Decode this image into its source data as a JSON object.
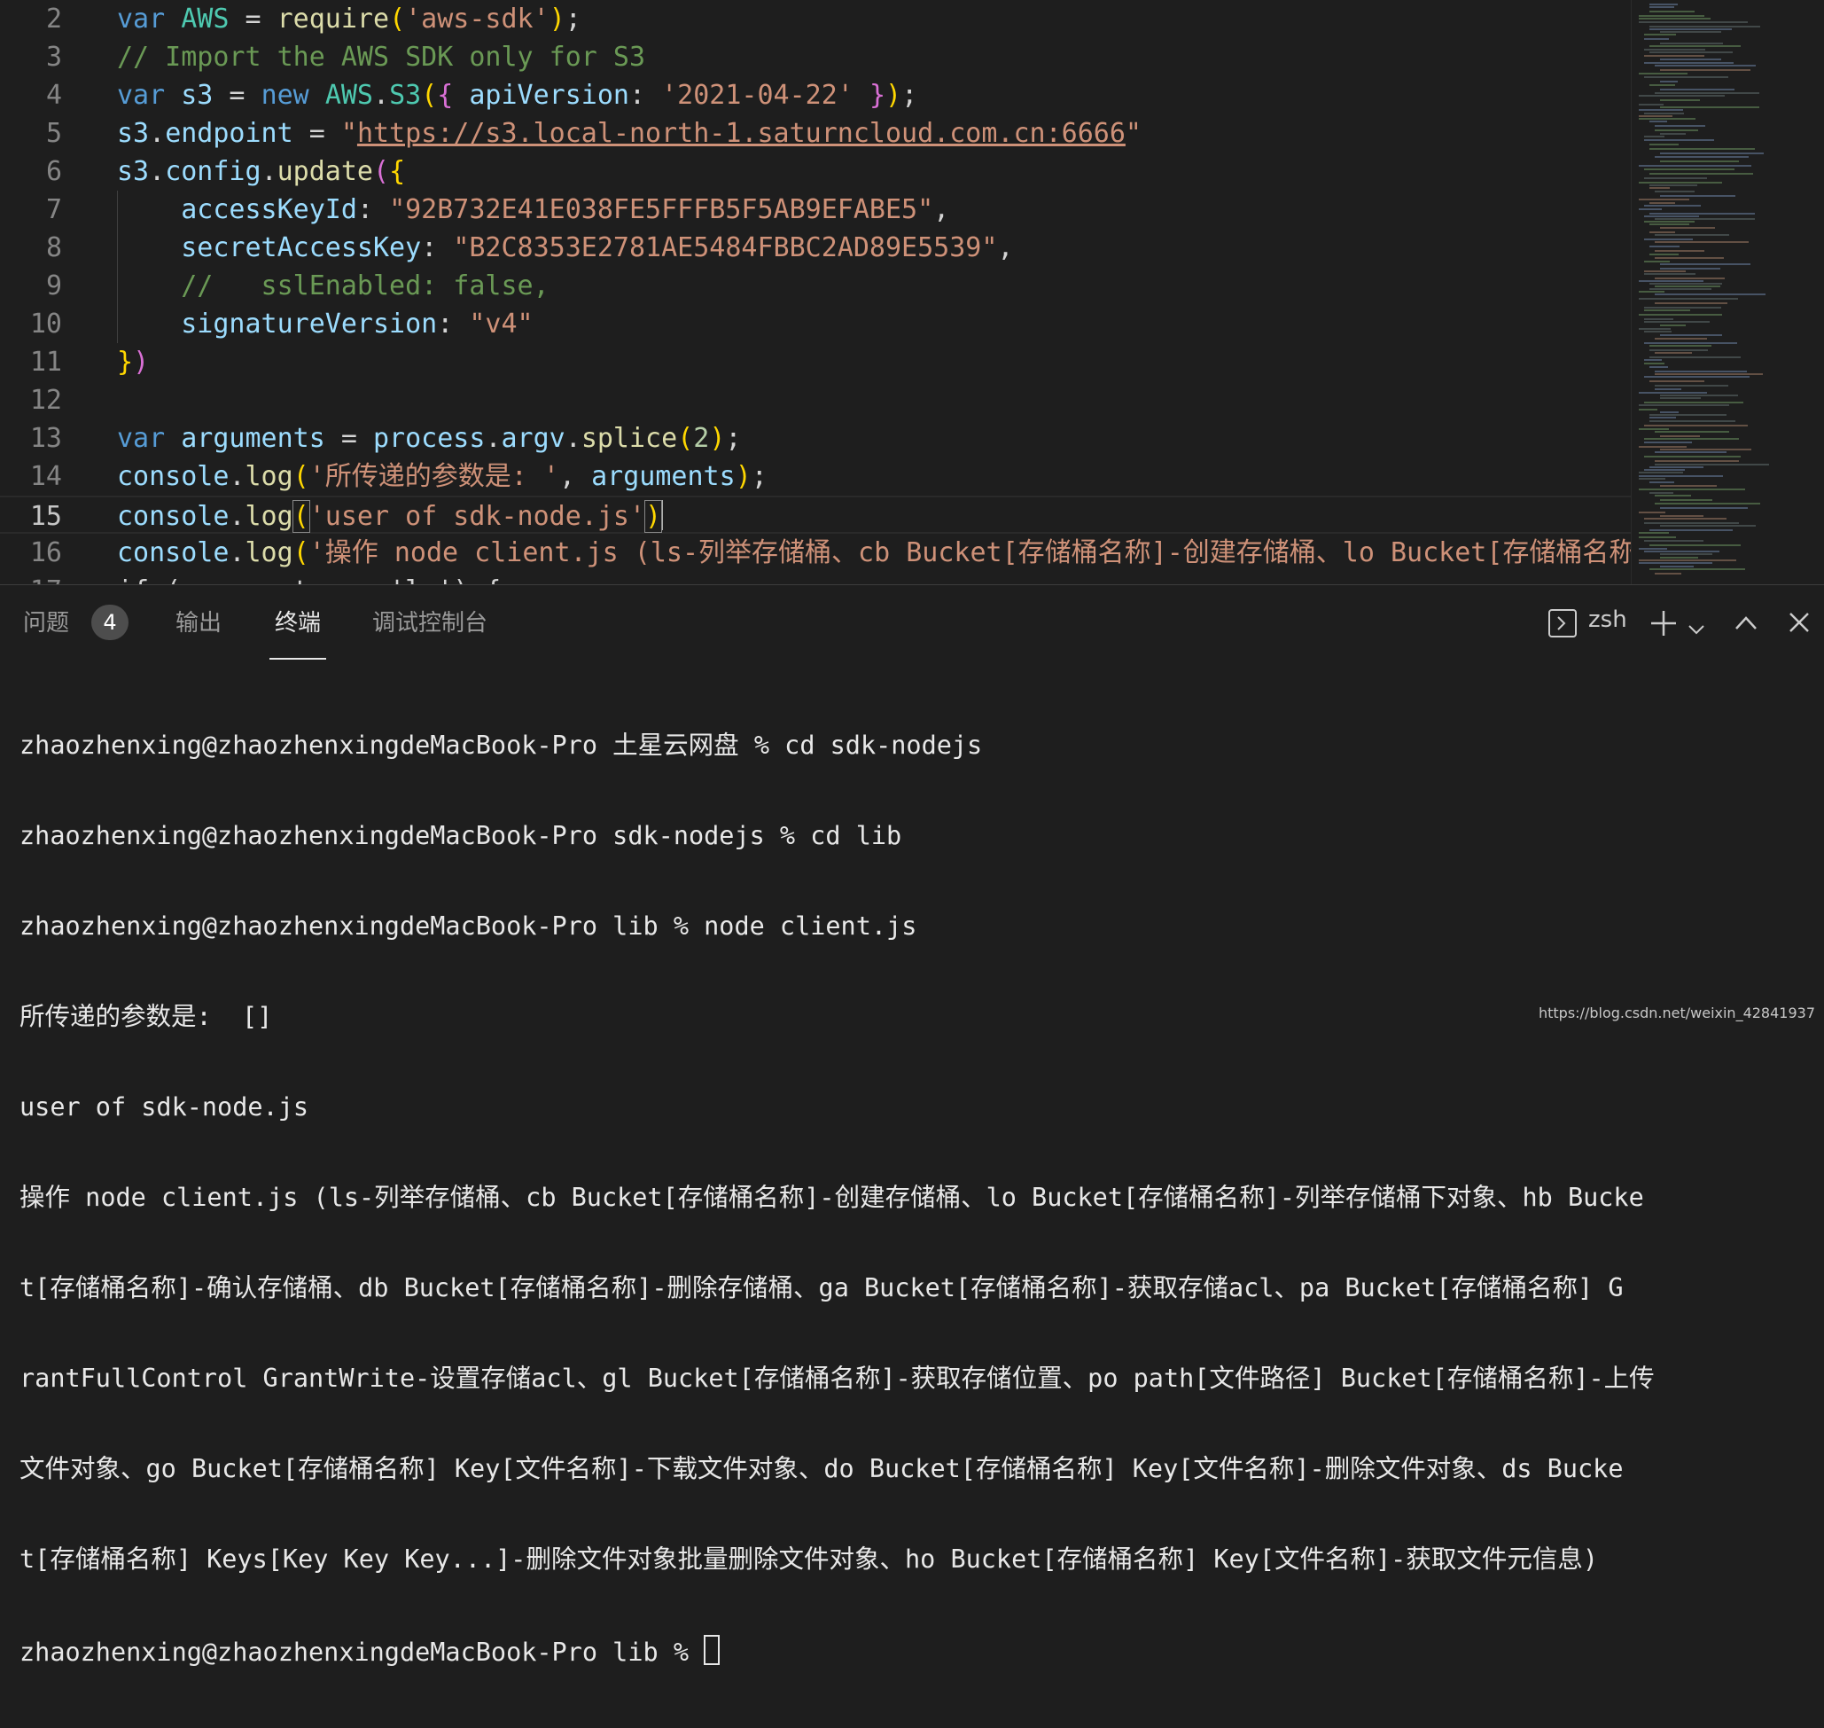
{
  "editor": {
    "active_line": "15",
    "lines": [
      {
        "num": "2",
        "code": "var AWS = require('aws-sdk');"
      },
      {
        "num": "3",
        "code": "// Import the AWS SDK only for S3"
      },
      {
        "num": "4",
        "code": "var s3 = new AWS.S3({ apiVersion: '2021-04-22' });"
      },
      {
        "num": "5",
        "code": "s3.endpoint = \"https://s3.local-north-1.saturncloud.com.cn:6666\""
      },
      {
        "num": "6",
        "code": "s3.config.update({"
      },
      {
        "num": "7",
        "code": "    accessKeyId: \"92B732E41E038FE5FFFB5F5AB9EFABE5\","
      },
      {
        "num": "8",
        "code": "    secretAccessKey: \"B2C8353E2781AE5484FBBC2AD89E5539\","
      },
      {
        "num": "9",
        "code": "    //   sslEnabled: false,"
      },
      {
        "num": "10",
        "code": "    signatureVersion: \"v4\""
      },
      {
        "num": "11",
        "code": "})"
      },
      {
        "num": "12",
        "code": ""
      },
      {
        "num": "13",
        "code": "var arguments = process.argv.splice(2);"
      },
      {
        "num": "14",
        "code": "console.log('所传递的参数是: ', arguments);"
      },
      {
        "num": "15",
        "code": "console.log('user of sdk-node.js')"
      },
      {
        "num": "16",
        "code": "console.log('操作 node client.js (ls-列举存储桶、cb Bucket[存储桶名称]-创建存储桶、lo Bucket[存储桶名称]-列"
      },
      {
        "num": "17",
        "code": "if (arguments == 'ls') {"
      }
    ]
  },
  "panel": {
    "tabs": [
      {
        "label": "问题",
        "badge": "4"
      },
      {
        "label": "输出"
      },
      {
        "label": "终端",
        "active": true
      },
      {
        "label": "调试控制台"
      }
    ],
    "shell_label": "zsh",
    "terminal_lines": [
      "zhaozhenxing@zhaozhenxingdeMacBook-Pro 土星云网盘 % cd sdk-nodejs",
      "zhaozhenxing@zhaozhenxingdeMacBook-Pro sdk-nodejs % cd lib",
      "zhaozhenxing@zhaozhenxingdeMacBook-Pro lib % node client.js",
      "所传递的参数是:  []",
      "user of sdk-node.js",
      "操作 node client.js (ls-列举存储桶、cb Bucket[存储桶名称]-创建存储桶、lo Bucket[存储桶名称]-列举存储桶下对象、hb Bucke",
      "t[存储桶名称]-确认存储桶、db Bucket[存储桶名称]-删除存储桶、ga Bucket[存储桶名称]-获取存储acl、pa Bucket[存储桶名称] G",
      "rantFullControl GrantWrite-设置存储acl、gl Bucket[存储桶名称]-获取存储位置、po path[文件路径] Bucket[存储桶名称]-上传",
      "文件对象、go Bucket[存储桶名称] Key[文件名称]-下载文件对象、do Bucket[存储桶名称] Key[文件名称]-删除文件对象、ds Bucke",
      "t[存储桶名称] Keys[Key Key Key...]-删除文件对象批量删除文件对象、ho Bucket[存储桶名称] Key[文件名称]-获取文件元信息)"
    ],
    "prompt": "zhaozhenxing@zhaozhenxingdeMacBook-Pro lib % "
  },
  "watermark": "https://blog.csdn.net/weixin_42841937",
  "icons": [
    "terminal-icon",
    "plus-icon",
    "chevron-down-icon",
    "chevron-up-icon",
    "close-icon"
  ]
}
